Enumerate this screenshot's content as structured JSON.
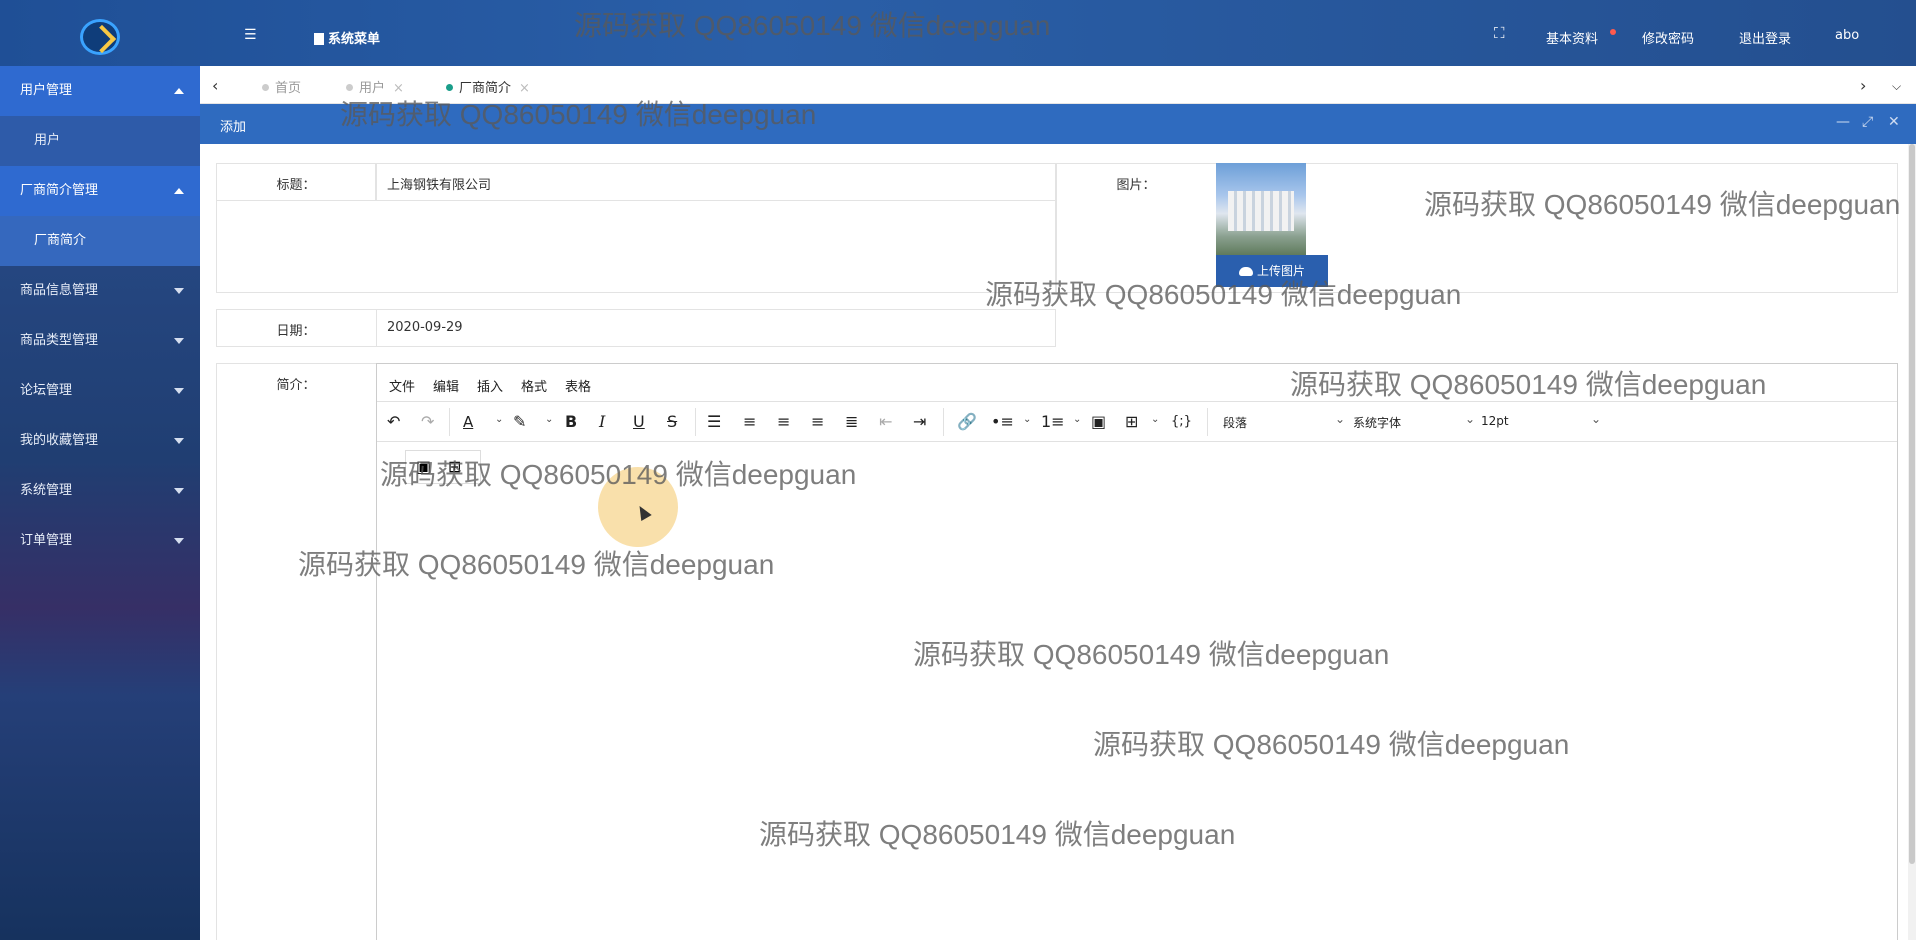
{
  "header": {
    "menu_label": "系统菜单",
    "links": [
      "基本资料",
      "修改密码",
      "退出登录",
      "abo"
    ]
  },
  "sidebar": {
    "items": [
      {
        "label": "用户管理",
        "type": "group-open"
      },
      {
        "label": "用户",
        "type": "sub"
      },
      {
        "label": "厂商简介管理",
        "type": "group-open"
      },
      {
        "label": "厂商简介",
        "type": "sub-active"
      },
      {
        "label": "商品信息管理",
        "type": "group"
      },
      {
        "label": "商品类型管理",
        "type": "group"
      },
      {
        "label": "论坛管理",
        "type": "group"
      },
      {
        "label": "我的收藏管理",
        "type": "group"
      },
      {
        "label": "系统管理",
        "type": "group"
      },
      {
        "label": "订单管理",
        "type": "group"
      }
    ]
  },
  "tabs": [
    {
      "label": "首页",
      "active": false
    },
    {
      "label": "用户",
      "active": false
    },
    {
      "label": "厂商简介",
      "active": true
    }
  ],
  "dialog": {
    "title": "添加"
  },
  "form": {
    "title_label": "标题：",
    "title_value": "上海钢铁有限公司",
    "image_label": "图片：",
    "upload_label": "上传图片",
    "date_label": "日期：",
    "date_value": "2020-09-29",
    "intro_label": "简介："
  },
  "editor": {
    "menus": [
      "文件",
      "编辑",
      "插入",
      "格式",
      "表格"
    ],
    "block_format": "段落",
    "font_family": "系统字体",
    "font_size": "12pt"
  },
  "watermark": "源码获取 QQ86050149 微信deepguan"
}
